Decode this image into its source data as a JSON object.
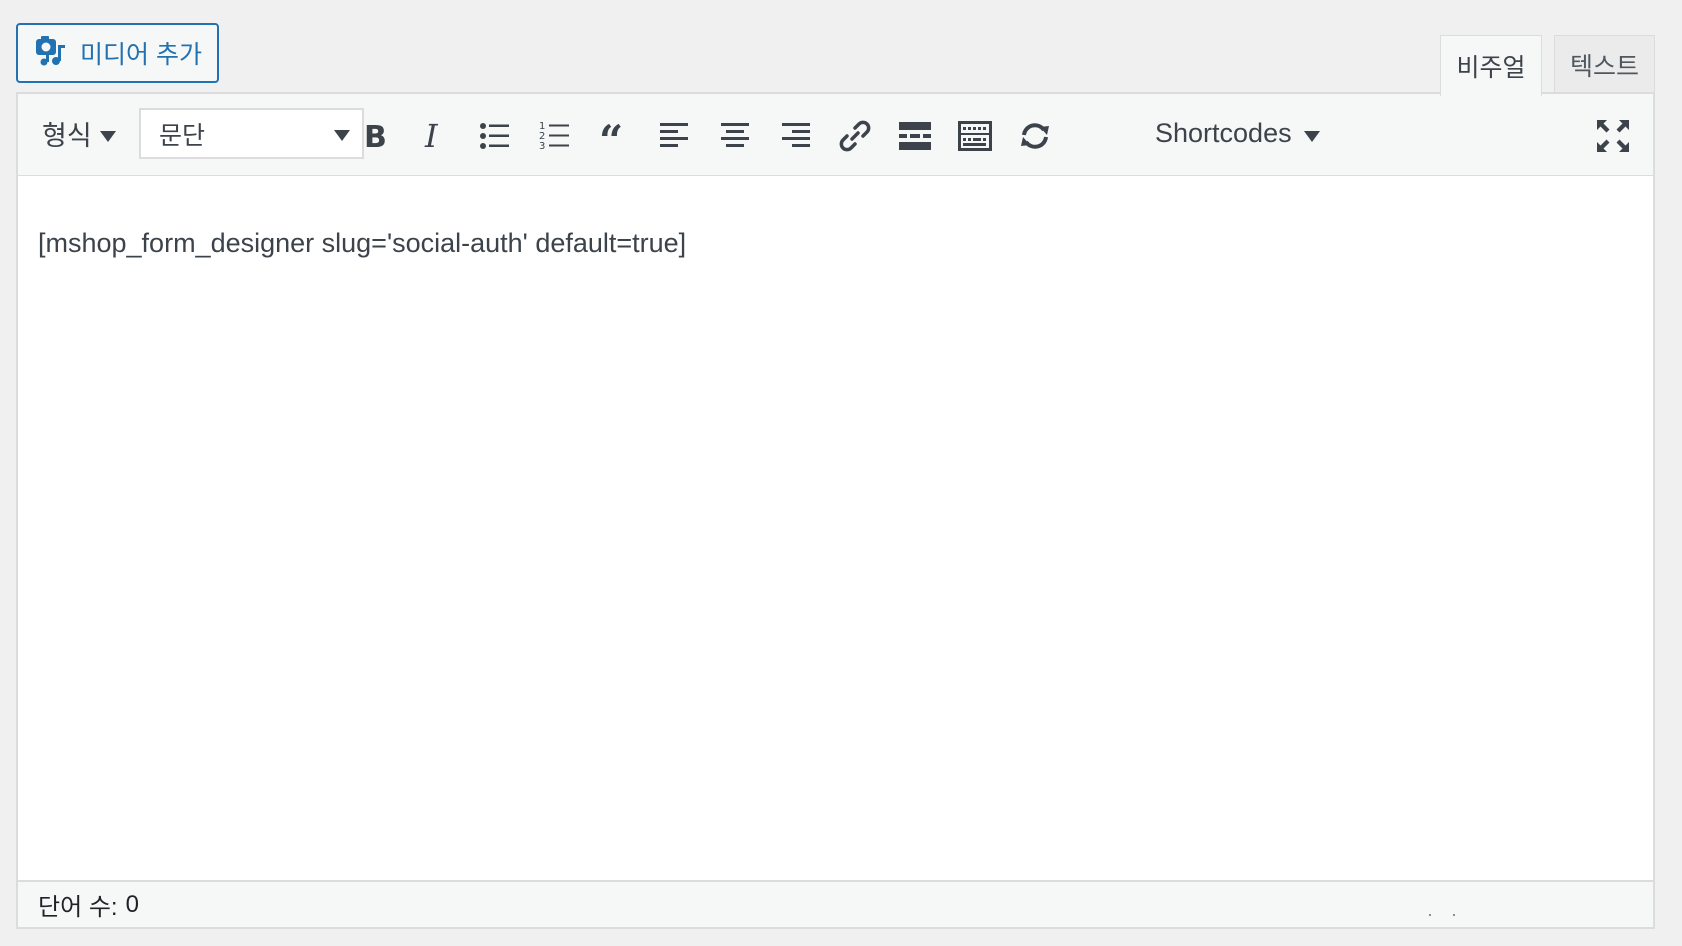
{
  "media_button": {
    "label": "미디어 추가",
    "icon": "media-add-icon"
  },
  "tabs": [
    {
      "label": "비주얼",
      "active": true
    },
    {
      "label": "텍스트",
      "active": false
    }
  ],
  "toolbar": {
    "format_menu": "형식",
    "paragraph_select": "문단",
    "shortcodes_menu": "Shortcodes",
    "buttons": [
      "bold-icon",
      "italic-icon",
      "bulleted-list-icon",
      "numbered-list-icon",
      "blockquote-icon",
      "align-left-icon",
      "align-center-icon",
      "align-right-icon",
      "link-icon",
      "read-more-icon",
      "toolbar-toggle-icon",
      "refresh-icon",
      "fullscreen-icon"
    ]
  },
  "editor": {
    "content": "[mshop_form_designer slug='social-auth' default=true]"
  },
  "status": {
    "word_count_label": "단어 수:",
    "word_count": "0"
  },
  "colors": {
    "accent": "#2271b1",
    "icon": "#3c434a",
    "border": "#dcdcde",
    "background": "#f0f0f1"
  }
}
